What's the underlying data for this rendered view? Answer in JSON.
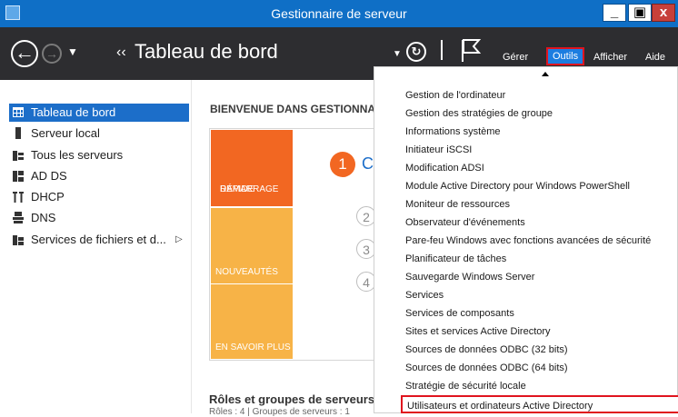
{
  "window": {
    "title": "Gestionnaire de serveur",
    "controls": {
      "minimize": "_",
      "maximize": "▣",
      "close": "x"
    }
  },
  "toolbar": {
    "breadcrumb": "Tableau de bord",
    "menus": [
      "Gérer",
      "Outils",
      "Afficher",
      "Aide"
    ],
    "active_menu": "Outils"
  },
  "sidebar": {
    "items": [
      {
        "label": "Tableau de bord",
        "active": true,
        "icon": "dashboard-icon"
      },
      {
        "label": "Serveur local",
        "active": false,
        "icon": "server-icon"
      },
      {
        "label": "Tous les serveurs",
        "active": false,
        "icon": "servers-icon"
      },
      {
        "label": "AD DS",
        "active": false,
        "icon": "adds-icon"
      },
      {
        "label": "DHCP",
        "active": false,
        "icon": "dhcp-icon"
      },
      {
        "label": "DNS",
        "active": false,
        "icon": "dns-icon"
      },
      {
        "label": "Services de fichiers et d...",
        "active": false,
        "icon": "file-services-icon",
        "expandable": true
      }
    ]
  },
  "main": {
    "welcome": "BIENVENUE DANS GESTIONNA",
    "tiles": [
      {
        "line1": "DÉMARRAGE",
        "line2": "RAPIDE"
      },
      {
        "line1": "NOUVEAUTÉS",
        "line2": ""
      },
      {
        "line1": "EN SAVOIR PLUS",
        "line2": ""
      }
    ],
    "steps": [
      "1",
      "2",
      "3",
      "4"
    ],
    "step1_tail": "C",
    "roles_title": "Rôles et groupes de serveurs",
    "roles_sub": "Rôles : 4  |  Groupes de serveurs : 1"
  },
  "dropdown": {
    "items": [
      "Gestion de l'ordinateur",
      "Gestion des stratégies de groupe",
      "Informations système",
      "Initiateur iSCSI",
      "Modification ADSI",
      "Module Active Directory pour Windows PowerShell",
      "Moniteur de ressources",
      "Observateur d'événements",
      "Pare-feu Windows avec fonctions avancées de sécurité",
      "Planificateur de tâches",
      "Sauvegarde Windows Server",
      "Services",
      "Services de composants",
      "Sites et services Active Directory",
      "Sources de données ODBC (32 bits)",
      "Sources de données ODBC (64 bits)",
      "Stratégie de sécurité locale",
      "Utilisateurs et ordinateurs Active Directory"
    ],
    "highlighted": "Utilisateurs et ordinateurs Active Directory"
  },
  "colors": {
    "titlebar": "#0f6fc6",
    "toolbar": "#2d2d30",
    "accent": "#1c6ec9",
    "orange": "#f26722",
    "amber": "#f7b347",
    "highlight_border": "#e0141e"
  }
}
